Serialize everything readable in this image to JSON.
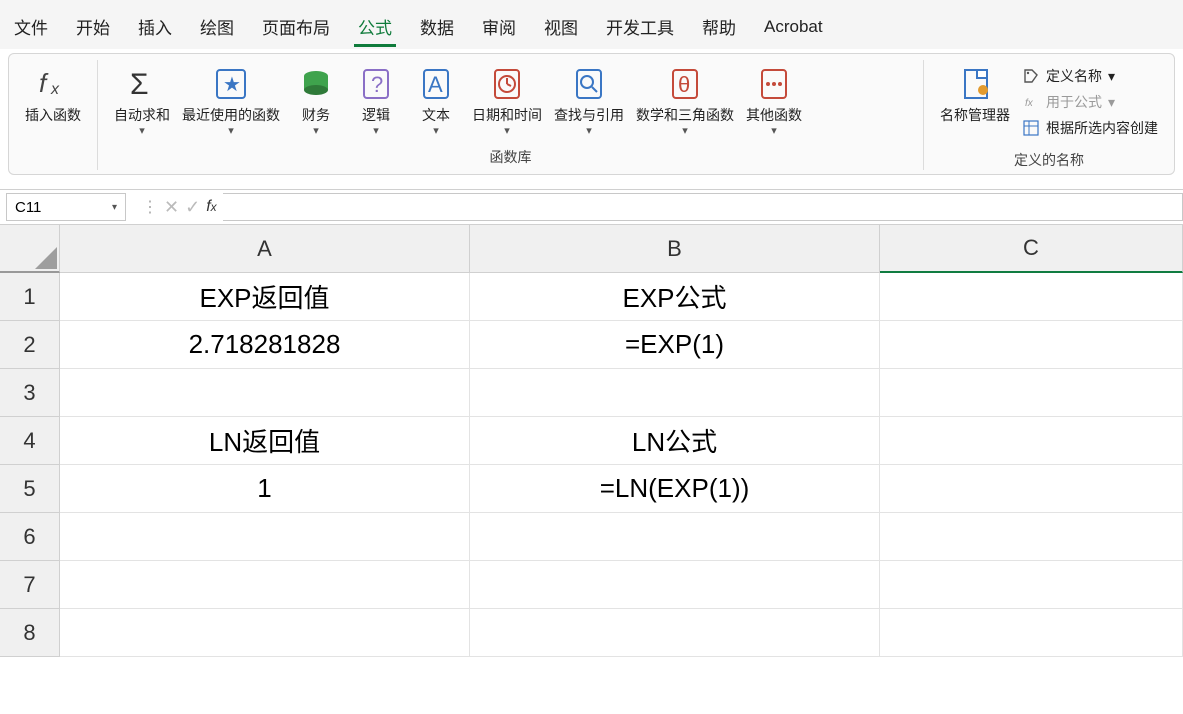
{
  "menu": {
    "items": [
      "文件",
      "开始",
      "插入",
      "绘图",
      "页面布局",
      "公式",
      "数据",
      "审阅",
      "视图",
      "开发工具",
      "帮助",
      "Acrobat"
    ],
    "activeIndex": 5
  },
  "ribbon": {
    "insertFunction": "插入函数",
    "autoSum": "自动求和",
    "recent": "最近使用的函数",
    "financial": "财务",
    "logical": "逻辑",
    "text": "文本",
    "datetime": "日期和时间",
    "lookup": "查找与引用",
    "mathTrig": "数学和三角函数",
    "more": "其他函数",
    "groupLabelLib": "函数库",
    "nameManager": "名称管理器",
    "defineName": "定义名称",
    "useInFormula": "用于公式",
    "createFromSel": "根据所选内容创建",
    "definedNamesLabel": "定义的名称"
  },
  "nameBox": "C11",
  "formulaBar": "",
  "grid": {
    "columns": [
      "A",
      "B",
      "C"
    ],
    "rows": [
      {
        "n": 1,
        "A": "EXP返回值",
        "B": "EXP公式",
        "C": ""
      },
      {
        "n": 2,
        "A": "2.718281828",
        "B": "=EXP(1)",
        "C": ""
      },
      {
        "n": 3,
        "A": "",
        "B": "",
        "C": ""
      },
      {
        "n": 4,
        "A": "LN返回值",
        "B": "LN公式",
        "C": ""
      },
      {
        "n": 5,
        "A": "1",
        "B": "=LN(EXP(1))",
        "C": ""
      },
      {
        "n": 6,
        "A": "",
        "B": "",
        "C": ""
      },
      {
        "n": 7,
        "A": "",
        "B": "",
        "C": ""
      },
      {
        "n": 8,
        "A": "",
        "B": "",
        "C": ""
      }
    ],
    "selected": {
      "col": "C",
      "row": 11
    }
  }
}
